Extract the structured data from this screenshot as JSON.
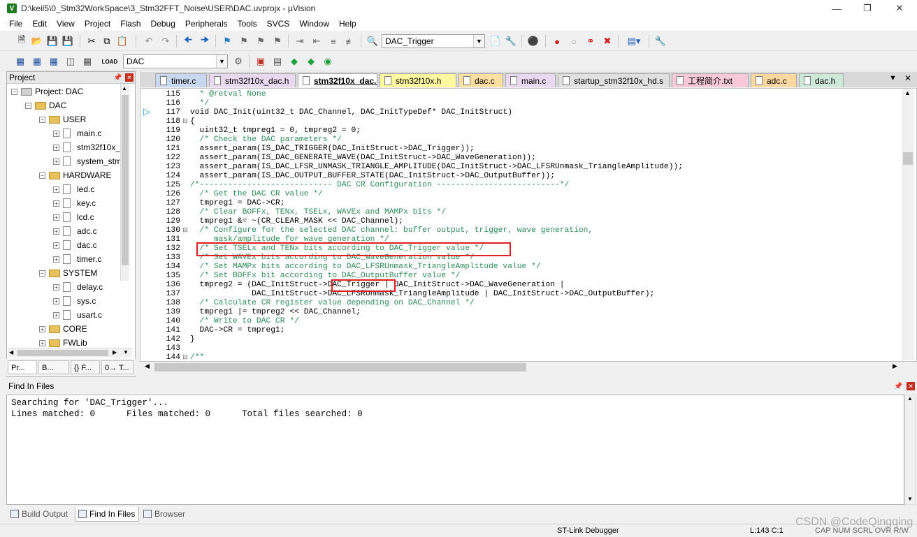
{
  "window": {
    "title": "D:\\keil5\\0_Stm32WorkSpace\\3_Stm32FFT_Noise\\USER\\DAC.uvprojx - µVision",
    "icon_letter": "V"
  },
  "menu": [
    "File",
    "Edit",
    "View",
    "Project",
    "Flash",
    "Debug",
    "Peripherals",
    "Tools",
    "SVCS",
    "Window",
    "Help"
  ],
  "toolbar1": {
    "find_combo": "DAC_Trigger"
  },
  "toolbar2": {
    "target_combo": "DAC"
  },
  "project": {
    "header": "Project",
    "tree": [
      {
        "label": "Project: DAC",
        "level": 0
      },
      {
        "label": "DAC",
        "level": 1
      },
      {
        "label": "USER",
        "level": 2
      },
      {
        "label": "main.c",
        "level": 3
      },
      {
        "label": "stm32f10x_",
        "level": 3
      },
      {
        "label": "system_stm",
        "level": 3
      },
      {
        "label": "HARDWARE",
        "level": 2
      },
      {
        "label": "led.c",
        "level": 3
      },
      {
        "label": "key.c",
        "level": 3
      },
      {
        "label": "lcd.c",
        "level": 3
      },
      {
        "label": "adc.c",
        "level": 3
      },
      {
        "label": "dac.c",
        "level": 3
      },
      {
        "label": "timer.c",
        "level": 3
      },
      {
        "label": "SYSTEM",
        "level": 2
      },
      {
        "label": "delay.c",
        "level": 3
      },
      {
        "label": "sys.c",
        "level": 3
      },
      {
        "label": "usart.c",
        "level": 3
      },
      {
        "label": "CORE",
        "level": 2
      },
      {
        "label": "FWLib",
        "level": 2
      }
    ],
    "tabs": [
      "Pr...",
      "B...",
      "{} F...",
      "0→ T..."
    ]
  },
  "editor_tabs": [
    {
      "label": "timer.c",
      "color": "#c9d7ee"
    },
    {
      "label": "stm32f10x_dac.h",
      "color": "#e8d8f0"
    },
    {
      "label": "stm32f10x_dac.c",
      "color": "#ffffff",
      "active": true
    },
    {
      "label": "stm32f10x.h",
      "color": "#fff8a0"
    },
    {
      "label": "dac.c",
      "color": "#ffe0a0"
    },
    {
      "label": "main.c",
      "color": "#e8d8f0"
    },
    {
      "label": "startup_stm32f10x_hd.s",
      "color": "#e0e0e0"
    },
    {
      "label": "工程简介.txt",
      "color": "#f6c8d8"
    },
    {
      "label": "adc.c",
      "color": "#ffd7a0"
    },
    {
      "label": "dac.h",
      "color": "#cde8d8"
    }
  ],
  "code": [
    {
      "n": "115",
      "fold": "",
      "text": "  * @retval None",
      "cls": "cmt"
    },
    {
      "n": "116",
      "fold": "",
      "text": "  */",
      "cls": "cmt"
    },
    {
      "n": "117",
      "fold": "",
      "text": "void DAC_Init(uint32_t DAC_Channel, DAC_InitTypeDef* DAC_InitStruct)",
      "cls": ""
    },
    {
      "n": "118",
      "fold": "⊟",
      "text": "{",
      "cls": ""
    },
    {
      "n": "119",
      "fold": "",
      "text": "  uint32_t tmpreg1 = 0, tmpreg2 = 0;",
      "cls": ""
    },
    {
      "n": "120",
      "fold": "",
      "text": "  /* Check the DAC parameters */",
      "cls": "cmt"
    },
    {
      "n": "121",
      "fold": "",
      "text": "  assert_param(IS_DAC_TRIGGER(DAC_InitStruct->DAC_Trigger));",
      "cls": ""
    },
    {
      "n": "122",
      "fold": "",
      "text": "  assert_param(IS_DAC_GENERATE_WAVE(DAC_InitStruct->DAC_WaveGeneration));",
      "cls": ""
    },
    {
      "n": "123",
      "fold": "",
      "text": "  assert_param(IS_DAC_LFSR_UNMASK_TRIANGLE_AMPLITUDE(DAC_InitStruct->DAC_LFSRUnmask_TriangleAmplitude));",
      "cls": ""
    },
    {
      "n": "124",
      "fold": "",
      "text": "  assert_param(IS_DAC_OUTPUT_BUFFER_STATE(DAC_InitStruct->DAC_OutputBuffer));",
      "cls": ""
    },
    {
      "n": "125",
      "fold": "",
      "text": "/*---------------------------- DAC CR Configuration --------------------------*/",
      "cls": "cmt"
    },
    {
      "n": "126",
      "fold": "",
      "text": "  /* Get the DAC CR value */",
      "cls": "cmt"
    },
    {
      "n": "127",
      "fold": "",
      "text": "  tmpreg1 = DAC->CR;",
      "cls": ""
    },
    {
      "n": "128",
      "fold": "",
      "text": "  /* Clear BOFFx, TENx, TSELx, WAVEx and MAMPx bits */",
      "cls": "cmt"
    },
    {
      "n": "129",
      "fold": "",
      "text": "  tmpreg1 &= ~(CR_CLEAR_MASK << DAC_Channel);",
      "cls": ""
    },
    {
      "n": "130",
      "fold": "⊟",
      "text": "  /* Configure for the selected DAC channel: buffer output, trigger, wave generation,",
      "cls": "cmt"
    },
    {
      "n": "131",
      "fold": "",
      "text": "     mask/amplitude for wave generation */",
      "cls": "cmt"
    },
    {
      "n": "132",
      "fold": "",
      "text": "  /* Set TSELx and TENx bits according to DAC_Trigger value */",
      "cls": "cmt"
    },
    {
      "n": "133",
      "fold": "",
      "text": "  /* Set WAVEx bits according to DAC_WaveGeneration value */",
      "cls": "cmt"
    },
    {
      "n": "134",
      "fold": "",
      "text": "  /* Set MAMPx bits according to DAC_LFSRUnmask_TriangleAmplitude value */",
      "cls": "cmt"
    },
    {
      "n": "135",
      "fold": "",
      "text": "  /* Set BOFFx bit according to DAC_OutputBuffer value */",
      "cls": "cmt"
    },
    {
      "n": "136",
      "fold": "",
      "text": "  tmpreg2 = (DAC_InitStruct->DAC_Trigger | DAC_InitStruct->DAC_WaveGeneration |",
      "cls": ""
    },
    {
      "n": "137",
      "fold": "",
      "text": "             DAC_InitStruct->DAC_LFSRUnmask_TriangleAmplitude | DAC_InitStruct->DAC_OutputBuffer);",
      "cls": ""
    },
    {
      "n": "138",
      "fold": "",
      "text": "  /* Calculate CR register value depending on DAC_Channel */",
      "cls": "cmt"
    },
    {
      "n": "139",
      "fold": "",
      "text": "  tmpreg1 |= tmpreg2 << DAC_Channel;",
      "cls": ""
    },
    {
      "n": "140",
      "fold": "",
      "text": "  /* Write to DAC CR */",
      "cls": "cmt"
    },
    {
      "n": "141",
      "fold": "",
      "text": "  DAC->CR = tmpreg1;",
      "cls": ""
    },
    {
      "n": "142",
      "fold": "",
      "text": "}",
      "cls": ""
    },
    {
      "n": "143",
      "fold": "",
      "text": "",
      "cls": ""
    },
    {
      "n": "144",
      "fold": "⊟",
      "text": "/**",
      "cls": "cmt"
    }
  ],
  "find_panel": {
    "header": "Find In Files",
    "lines": [
      "Searching for 'DAC_Trigger'...",
      "Lines matched: 0      Files matched: 0      Total files searched: 0"
    ]
  },
  "bottom_tabs": [
    "Build Output",
    "Find In Files",
    "Browser"
  ],
  "status": {
    "debugger": "ST-Link Debugger",
    "position": "L:143 C:1",
    "keys": "CAP  NUM  SCRL  OVR  R/W",
    "watermark": "CSDN @CodeQingqing"
  }
}
